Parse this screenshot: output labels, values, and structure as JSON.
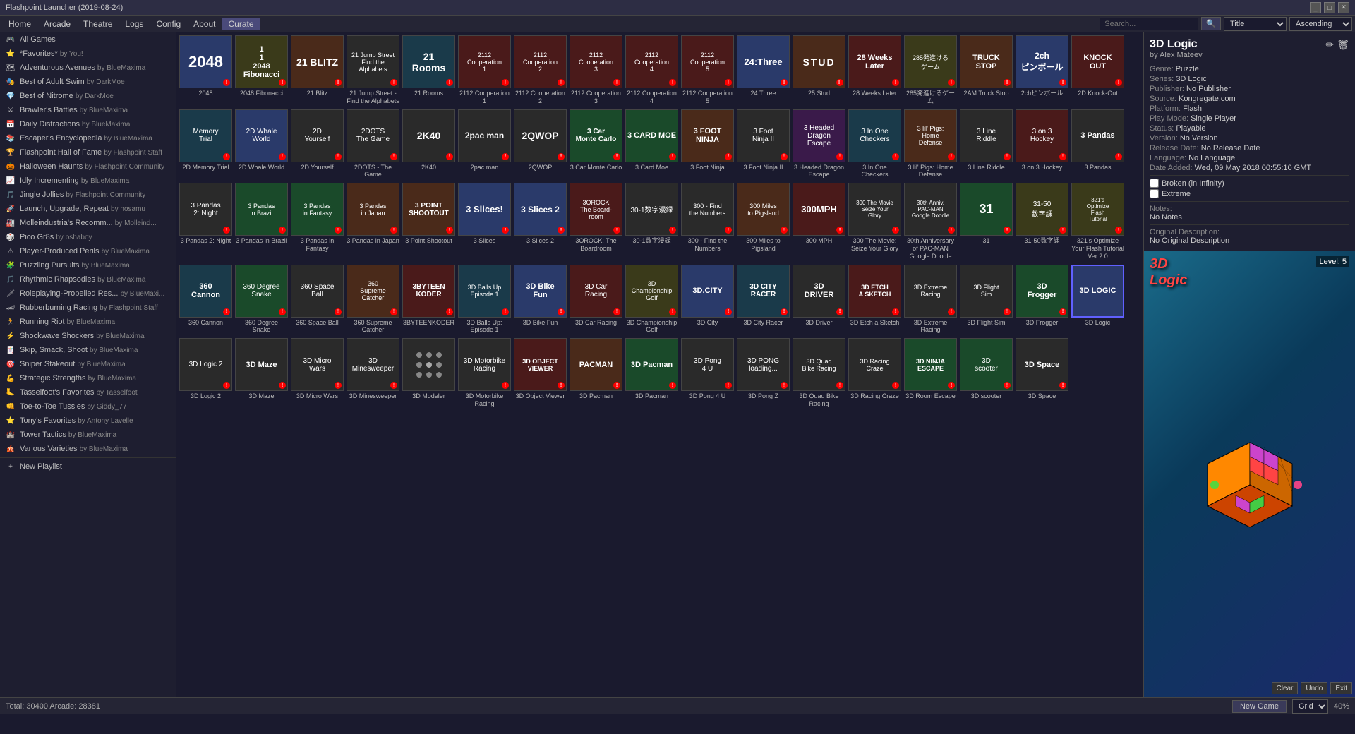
{
  "titlebar": {
    "title": "Flashpoint Launcher (2019-08-24)",
    "controls": [
      "_",
      "□",
      "✕"
    ]
  },
  "menubar": {
    "items": [
      "Home",
      "Arcade",
      "Theatre",
      "Logs",
      "Config",
      "About",
      "Curate"
    ]
  },
  "searchbar": {
    "placeholder": "Search...",
    "sort_by": "Title",
    "order": "Ascending",
    "search_icon": "🔍"
  },
  "sidebar": {
    "items": [
      {
        "icon": "🎮",
        "label": "All Games",
        "by": ""
      },
      {
        "icon": "⭐",
        "label": "*Favorites*",
        "by": "by You!"
      },
      {
        "icon": "🗺",
        "label": "Adventurous Avenues",
        "by": "by BlueMaxima"
      },
      {
        "icon": "🎭",
        "label": "Best of Adult Swim",
        "by": "by DarkMoe"
      },
      {
        "icon": "💎",
        "label": "Best of Nitrome",
        "by": "by DarkMoe"
      },
      {
        "icon": "⚔",
        "label": "Brawler's Battles",
        "by": "by BlueMaxima"
      },
      {
        "icon": "📅",
        "label": "Daily Distractions",
        "by": "by BlueMaxima"
      },
      {
        "icon": "📚",
        "label": "Escaper's Encyclopedia",
        "by": "by BlueMaxima"
      },
      {
        "icon": "🏆",
        "label": "Flashpoint Hall of Fame",
        "by": "by Flashpoint Staff"
      },
      {
        "icon": "🎃",
        "label": "Halloween Haunts",
        "by": "by Flashpoint Community"
      },
      {
        "icon": "📈",
        "label": "Idly Incrementing",
        "by": "by BlueMaxima"
      },
      {
        "icon": "🎵",
        "label": "Jingle Jollies",
        "by": "by Flashpoint Community"
      },
      {
        "icon": "🚀",
        "label": "Launch, Upgrade, Repeat",
        "by": "by nosamu"
      },
      {
        "icon": "🏭",
        "label": "Molleindustria's Recomm...",
        "by": "by Molleind..."
      },
      {
        "icon": "🎲",
        "label": "Pico Gr8s",
        "by": "by oshaboy"
      },
      {
        "icon": "⚠",
        "label": "Player-Produced Perils",
        "by": "by BlueMaxima"
      },
      {
        "icon": "🧩",
        "label": "Puzzling Pursuits",
        "by": "by BlueMaxima"
      },
      {
        "icon": "🎵",
        "label": "Rhythmic Rhapsodies",
        "by": "by BlueMaxima"
      },
      {
        "icon": "🗡",
        "label": "Roleplaying-Propelled Res...",
        "by": "by BlueMaxi..."
      },
      {
        "icon": "🏎",
        "label": "Rubberburning Racing",
        "by": "by Flashpoint Staff"
      },
      {
        "icon": "🏃",
        "label": "Running Riot",
        "by": "by BlueMaxima"
      },
      {
        "icon": "⚡",
        "label": "Shockwave Shockers",
        "by": "by BlueMaxima"
      },
      {
        "icon": "🃏",
        "label": "Skip, Smack, Shoot",
        "by": "by BlueMaxima"
      },
      {
        "icon": "🎯",
        "label": "Sniper Stakeout",
        "by": "by BlueMaxima"
      },
      {
        "icon": "💪",
        "label": "Strategic Strengths",
        "by": "by BlueMaxima"
      },
      {
        "icon": "🦶",
        "label": "Tasselfoot's Favorites",
        "by": "by Tasselfoot"
      },
      {
        "icon": "👊",
        "label": "Toe-to-Toe Tussles",
        "by": "by Giddy_77"
      },
      {
        "icon": "⭐",
        "label": "Tony's Favorites",
        "by": "by Antony Lavelle"
      },
      {
        "icon": "🏰",
        "label": "Tower Tactics",
        "by": "by BlueMaxima"
      },
      {
        "icon": "🎪",
        "label": "Various Varieties",
        "by": "by BlueMaxima"
      },
      {
        "icon": "+",
        "label": "New Playlist",
        "by": ""
      }
    ]
  },
  "games": [
    {
      "name": "2048",
      "color": "t-blue"
    },
    {
      "name": "2048 Fibonacci",
      "color": "t-yellow"
    },
    {
      "name": "21 Blitz",
      "color": "t-orange"
    },
    {
      "name": "21 Jump Street - Find the Alphabets",
      "color": "t-dark"
    },
    {
      "name": "21 Rooms",
      "color": "t-teal"
    },
    {
      "name": "2112 Cooperation 1",
      "color": "t-red"
    },
    {
      "name": "2112 Cooperation 2",
      "color": "t-red"
    },
    {
      "name": "2112 Cooperation 3",
      "color": "t-red"
    },
    {
      "name": "2112 Cooperation 4",
      "color": "t-red"
    },
    {
      "name": "2112 Cooperation 5",
      "color": "t-red"
    },
    {
      "name": "24:Three",
      "color": "t-blue"
    },
    {
      "name": "25 Stud",
      "color": "t-orange"
    },
    {
      "name": "28 Weeks Later",
      "color": "t-red"
    },
    {
      "name": "285発進けるゲーム",
      "color": "t-yellow"
    },
    {
      "name": "2AM Truck Stop",
      "color": "t-orange"
    },
    {
      "name": "2chピンボール",
      "color": "t-blue"
    },
    {
      "name": "2D Knock-Out",
      "color": "t-red"
    },
    {
      "name": "2D Memory Trial",
      "color": "t-teal"
    },
    {
      "name": "2D Whale World",
      "color": "t-blue"
    },
    {
      "name": "2D Yourself",
      "color": "t-dark"
    },
    {
      "name": "2DOTS - The Game",
      "color": "t-dark"
    },
    {
      "name": "2K40",
      "color": "t-dark"
    },
    {
      "name": "2pac man",
      "color": "t-dark"
    },
    {
      "name": "2QWOP",
      "color": "t-dark"
    },
    {
      "name": "3 Car Monte Carlo",
      "color": "t-green"
    },
    {
      "name": "3 Card Moe",
      "color": "t-green"
    },
    {
      "name": "3 Foot Ninja",
      "color": "t-orange"
    },
    {
      "name": "3 Foot Ninja II",
      "color": "t-dark"
    },
    {
      "name": "3 Headed Dragon Escape",
      "color": "t-purple"
    },
    {
      "name": "3 In One Checkers",
      "color": "t-teal"
    },
    {
      "name": "3 lil' Pigs: Home Defense",
      "color": "t-orange"
    },
    {
      "name": "3 Line Riddle",
      "color": "t-dark"
    },
    {
      "name": "3 on 3 Hockey",
      "color": "t-red"
    },
    {
      "name": "3 Pandas",
      "color": "t-dark"
    },
    {
      "name": "3 Pandas 2: Night",
      "color": "t-dark"
    },
    {
      "name": "3 Pandas in Brazil",
      "color": "t-green"
    },
    {
      "name": "3 Pandas in Fantasy",
      "color": "t-green"
    },
    {
      "name": "3 Pandas in Japan",
      "color": "t-orange"
    },
    {
      "name": "3 Point Shootout",
      "color": "t-orange"
    },
    {
      "name": "3 Slices",
      "color": "t-blue"
    },
    {
      "name": "3 Slices 2",
      "color": "t-blue"
    },
    {
      "name": "3OROCK: The Boardroom",
      "color": "t-red"
    },
    {
      "name": "30-1数字漫録",
      "color": "t-dark"
    },
    {
      "name": "300 - Find the Numbers",
      "color": "t-dark"
    },
    {
      "name": "300 Miles to Pigsland",
      "color": "t-orange"
    },
    {
      "name": "300 MPH",
      "color": "t-red"
    },
    {
      "name": "300 The Movie: Seize Your Glory",
      "color": "t-dark"
    },
    {
      "name": "30th Anniversary of PAC-MAN Google Doodle",
      "color": "t-dark"
    },
    {
      "name": "31",
      "color": "t-green"
    },
    {
      "name": "31-50数字課",
      "color": "t-yellow"
    },
    {
      "name": "321's Optimize Your Flash Tutorial Ver 2.0",
      "color": "t-yellow"
    },
    {
      "name": "360 Cannon",
      "color": "t-teal"
    },
    {
      "name": "360 Degree Snake",
      "color": "t-green"
    },
    {
      "name": "360 Space Ball",
      "color": "t-dark"
    },
    {
      "name": "360 Supreme Catcher",
      "color": "t-orange"
    },
    {
      "name": "3BYTEENKODER",
      "color": "t-red"
    },
    {
      "name": "3D Balls Up: Episode 1",
      "color": "t-teal"
    },
    {
      "name": "3D Bike Fun",
      "color": "t-blue"
    },
    {
      "name": "3D Car Racing",
      "color": "t-red"
    },
    {
      "name": "3D Championship Golf",
      "color": "t-yellow"
    },
    {
      "name": "3D City",
      "color": "t-blue"
    },
    {
      "name": "3D City Racer",
      "color": "t-teal"
    },
    {
      "name": "3D Driver",
      "color": "t-dark"
    },
    {
      "name": "3D Etch a Sketch",
      "color": "t-red"
    },
    {
      "name": "3D Extreme Racing",
      "color": "t-dark"
    },
    {
      "name": "3D Flight Sim",
      "color": "t-dark"
    },
    {
      "name": "3D Frogger",
      "color": "t-green"
    },
    {
      "name": "3D Logic",
      "color": "t-blue selected"
    },
    {
      "name": "3D Logic 2",
      "color": "t-dark"
    },
    {
      "name": "3D Maze",
      "color": "t-dark"
    },
    {
      "name": "3D Micro Wars",
      "color": "t-dark"
    },
    {
      "name": "3D Minesweeper",
      "color": "t-dark"
    },
    {
      "name": "3D Modeler",
      "color": "t-dark"
    },
    {
      "name": "3D Motorbike Racing",
      "color": "t-dark"
    },
    {
      "name": "3D Object Viewer",
      "color": "t-red"
    },
    {
      "name": "3D Pacman",
      "color": "t-orange"
    },
    {
      "name": "3D Pacman",
      "color": "t-green"
    },
    {
      "name": "3D Pong 4 U",
      "color": "t-dark"
    },
    {
      "name": "3D Pong Z",
      "color": "t-dark"
    },
    {
      "name": "3D Quad Bike Racing",
      "color": "t-dark"
    },
    {
      "name": "3D Racing Craze",
      "color": "t-dark"
    },
    {
      "name": "3D Room Escape",
      "color": "t-green"
    },
    {
      "name": "3D scooter",
      "color": "t-green"
    },
    {
      "name": "3D Space",
      "color": "t-dark"
    }
  ],
  "game_detail": {
    "title": "3D Logic",
    "author": "by Alex Mateev",
    "genre_label": "Genre:",
    "genre": "Puzzle",
    "series_label": "Series:",
    "series": "3D Logic",
    "publisher_label": "Publisher:",
    "publisher": "No Publisher",
    "source_label": "Source:",
    "source": "Kongregate.com",
    "platform_label": "Platform:",
    "platform": "Flash",
    "playmode_label": "Play Mode:",
    "playmode": "Single Player",
    "status_label": "Status:",
    "status": "Playable",
    "version_label": "Version:",
    "version": "No Version",
    "releasedate_label": "Release Date:",
    "releasedate": "No Release Date",
    "language_label": "Language:",
    "language": "No Language",
    "dateadded_label": "Date Added:",
    "dateadded": "Wed, 09 May 2018 00:55:10 GMT",
    "broken_label": "Broken (in Infinity)",
    "extreme_label": "Extreme",
    "notes_label": "Notes:",
    "notes": "No Notes",
    "original_desc_label": "Original Description:",
    "original_desc": "No Original Description",
    "preview_title": "3D Logic",
    "preview_level": "Level: 5",
    "edit_icon": "✏",
    "delete_icon": "🗑"
  },
  "statusbar": {
    "total": "Total: 30400  Arcade: 28381",
    "new_game": "New Game",
    "grid_label": "Grid ▼",
    "zoom": "40%"
  }
}
